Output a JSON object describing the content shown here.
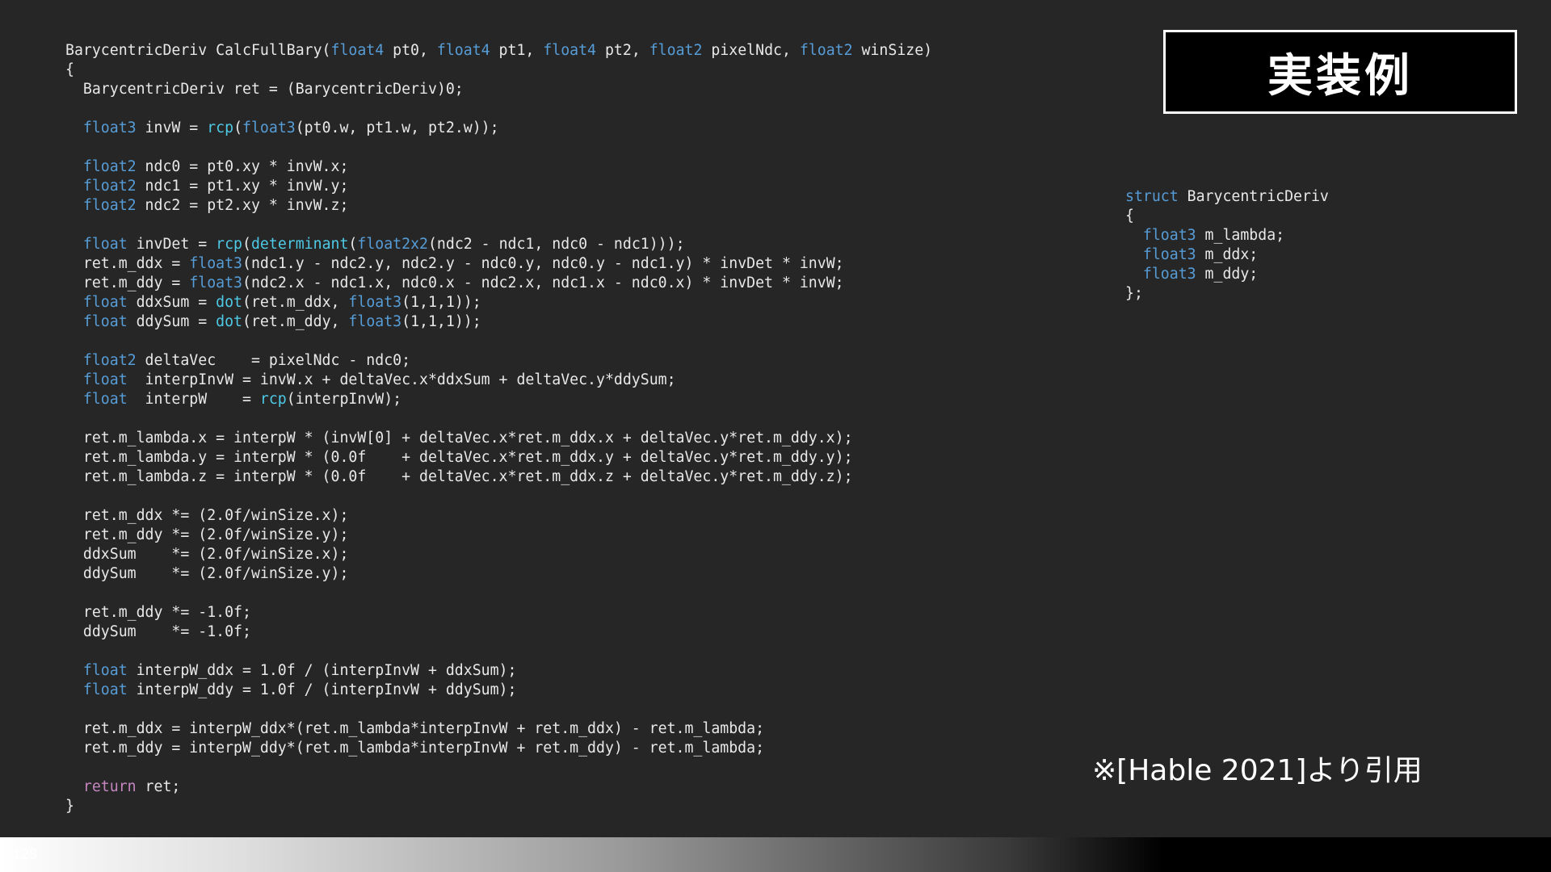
{
  "title": "実装例",
  "citation": "※[Hable 2021]より引用",
  "page_number": "128",
  "colors": {
    "background": "#262626",
    "code_text": "#e8e8e8",
    "keyword_type": "#569cd6",
    "function": "#4ec9e6",
    "control_keyword": "#c586c0",
    "title_box": "#000000",
    "title_border": "#ffffff"
  },
  "main_code": [
    [
      [
        "BarycentricDeriv CalcFullBary(",
        "p"
      ],
      [
        "float4",
        "t"
      ],
      [
        " pt0, ",
        "p"
      ],
      [
        "float4",
        "t"
      ],
      [
        " pt1, ",
        "p"
      ],
      [
        "float4",
        "t"
      ],
      [
        " pt2, ",
        "p"
      ],
      [
        "float2",
        "t"
      ],
      [
        " pixelNdc, ",
        "p"
      ],
      [
        "float2",
        "t"
      ],
      [
        " winSize)",
        "p"
      ]
    ],
    [
      [
        "{",
        "p"
      ]
    ],
    [
      [
        "  BarycentricDeriv ret = (BarycentricDeriv)0;",
        "p"
      ]
    ],
    [],
    [
      [
        "  ",
        "p"
      ],
      [
        "float3",
        "t"
      ],
      [
        " invW = ",
        "p"
      ],
      [
        "rcp",
        "f"
      ],
      [
        "(",
        "p"
      ],
      [
        "float3",
        "t"
      ],
      [
        "(pt0.w, pt1.w, pt2.w));",
        "p"
      ]
    ],
    [],
    [
      [
        "  ",
        "p"
      ],
      [
        "float2",
        "t"
      ],
      [
        " ndc0 = pt0.xy * invW.x;",
        "p"
      ]
    ],
    [
      [
        "  ",
        "p"
      ],
      [
        "float2",
        "t"
      ],
      [
        " ndc1 = pt1.xy * invW.y;",
        "p"
      ]
    ],
    [
      [
        "  ",
        "p"
      ],
      [
        "float2",
        "t"
      ],
      [
        " ndc2 = pt2.xy * invW.z;",
        "p"
      ]
    ],
    [],
    [
      [
        "  ",
        "p"
      ],
      [
        "float",
        "t"
      ],
      [
        " invDet = ",
        "p"
      ],
      [
        "rcp",
        "f"
      ],
      [
        "(",
        "p"
      ],
      [
        "determinant",
        "f"
      ],
      [
        "(",
        "p"
      ],
      [
        "float2x2",
        "t"
      ],
      [
        "(ndc2 - ndc1, ndc0 - ndc1)));",
        "p"
      ]
    ],
    [
      [
        "  ret.m_ddx = ",
        "p"
      ],
      [
        "float3",
        "t"
      ],
      [
        "(ndc1.y - ndc2.y, ndc2.y - ndc0.y, ndc0.y - ndc1.y) * invDet * invW;",
        "p"
      ]
    ],
    [
      [
        "  ret.m_ddy = ",
        "p"
      ],
      [
        "float3",
        "t"
      ],
      [
        "(ndc2.x - ndc1.x, ndc0.x - ndc2.x, ndc1.x - ndc0.x) * invDet * invW;",
        "p"
      ]
    ],
    [
      [
        "  ",
        "p"
      ],
      [
        "float",
        "t"
      ],
      [
        " ddxSum = ",
        "p"
      ],
      [
        "dot",
        "f"
      ],
      [
        "(ret.m_ddx, ",
        "p"
      ],
      [
        "float3",
        "t"
      ],
      [
        "(1,1,1));",
        "p"
      ]
    ],
    [
      [
        "  ",
        "p"
      ],
      [
        "float",
        "t"
      ],
      [
        " ddySum = ",
        "p"
      ],
      [
        "dot",
        "f"
      ],
      [
        "(ret.m_ddy, ",
        "p"
      ],
      [
        "float3",
        "t"
      ],
      [
        "(1,1,1));",
        "p"
      ]
    ],
    [],
    [
      [
        "  ",
        "p"
      ],
      [
        "float2",
        "t"
      ],
      [
        " deltaVec    = pixelNdc - ndc0;",
        "p"
      ]
    ],
    [
      [
        "  ",
        "p"
      ],
      [
        "float",
        "t"
      ],
      [
        "  interpInvW = invW.x + deltaVec.x*ddxSum + deltaVec.y*ddySum;",
        "p"
      ]
    ],
    [
      [
        "  ",
        "p"
      ],
      [
        "float",
        "t"
      ],
      [
        "  interpW    = ",
        "p"
      ],
      [
        "rcp",
        "f"
      ],
      [
        "(interpInvW);",
        "p"
      ]
    ],
    [],
    [
      [
        "  ret.m_lambda.x = interpW * (invW[0] + deltaVec.x*ret.m_ddx.x + deltaVec.y*ret.m_ddy.x);",
        "p"
      ]
    ],
    [
      [
        "  ret.m_lambda.y = interpW * (0.0f    + deltaVec.x*ret.m_ddx.y + deltaVec.y*ret.m_ddy.y);",
        "p"
      ]
    ],
    [
      [
        "  ret.m_lambda.z = interpW * (0.0f    + deltaVec.x*ret.m_ddx.z + deltaVec.y*ret.m_ddy.z);",
        "p"
      ]
    ],
    [],
    [
      [
        "  ret.m_ddx *= (2.0f/winSize.x);",
        "p"
      ]
    ],
    [
      [
        "  ret.m_ddy *= (2.0f/winSize.y);",
        "p"
      ]
    ],
    [
      [
        "  ddxSum    *= (2.0f/winSize.x);",
        "p"
      ]
    ],
    [
      [
        "  ddySum    *= (2.0f/winSize.y);",
        "p"
      ]
    ],
    [],
    [
      [
        "  ret.m_ddy *= -1.0f;",
        "p"
      ]
    ],
    [
      [
        "  ddySum    *= -1.0f;",
        "p"
      ]
    ],
    [],
    [
      [
        "  ",
        "p"
      ],
      [
        "float",
        "t"
      ],
      [
        " interpW_ddx = 1.0f / (interpInvW + ddxSum);",
        "p"
      ]
    ],
    [
      [
        "  ",
        "p"
      ],
      [
        "float",
        "t"
      ],
      [
        " interpW_ddy = 1.0f / (interpInvW + ddySum);",
        "p"
      ]
    ],
    [],
    [
      [
        "  ret.m_ddx = interpW_ddx*(ret.m_lambda*interpInvW + ret.m_ddx) - ret.m_lambda;",
        "p"
      ]
    ],
    [
      [
        "  ret.m_ddy = interpW_ddy*(ret.m_lambda*interpInvW + ret.m_ddy) - ret.m_lambda;",
        "p"
      ]
    ],
    [],
    [
      [
        "  ",
        "p"
      ],
      [
        "return",
        "k"
      ],
      [
        " ret;",
        "p"
      ]
    ],
    [
      [
        "}",
        "p"
      ]
    ]
  ],
  "struct_code": [
    [
      [
        "struct",
        "t"
      ],
      [
        " BarycentricDeriv",
        "p"
      ]
    ],
    [
      [
        "{",
        "p"
      ]
    ],
    [
      [
        "  ",
        "p"
      ],
      [
        "float3",
        "t"
      ],
      [
        " m_lambda;",
        "p"
      ]
    ],
    [
      [
        "  ",
        "p"
      ],
      [
        "float3",
        "t"
      ],
      [
        " m_ddx;",
        "p"
      ]
    ],
    [
      [
        "  ",
        "p"
      ],
      [
        "float3",
        "t"
      ],
      [
        " m_ddy;",
        "p"
      ]
    ],
    [
      [
        "};",
        "p"
      ]
    ]
  ]
}
